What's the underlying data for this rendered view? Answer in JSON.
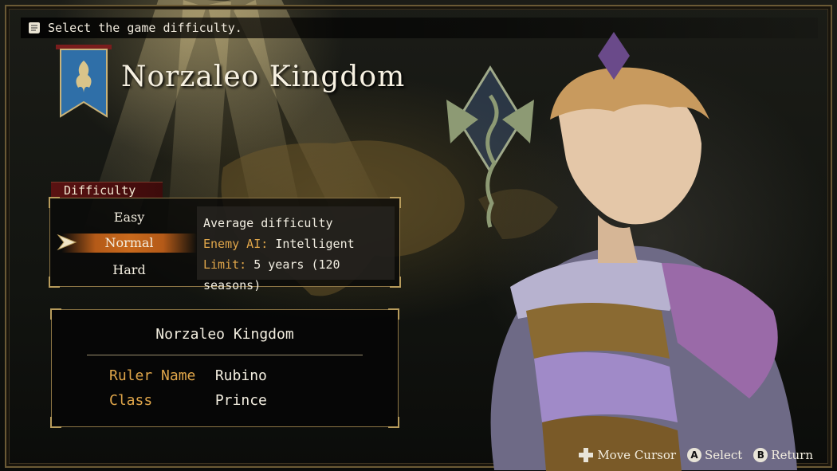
{
  "hint_bar": {
    "text": "Select the game difficulty.",
    "icon": "scroll-icon"
  },
  "header": {
    "title": "Norzaleo Kingdom",
    "banner_icon": "dragon-banner-icon"
  },
  "difficulty": {
    "tab_label": "Difficulty",
    "options": [
      "Easy",
      "Normal",
      "Hard"
    ],
    "selected": "Normal",
    "info": {
      "description": "Average difficulty",
      "enemy_ai_label": "Enemy AI:",
      "enemy_ai_value": "Intelligent",
      "limit_label": "Limit:",
      "limit_value": "5 years (120 seasons)"
    }
  },
  "info_panel": {
    "title": "Norzaleo Kingdom",
    "ruler_label": "Ruler Name",
    "ruler_value": "Rubino",
    "class_label": "Class",
    "class_value": "Prince"
  },
  "button_hints": [
    {
      "icon": "dpad-icon",
      "label": "Move Cursor"
    },
    {
      "icon": "a-button-icon",
      "glyph": "A",
      "label": "Select"
    },
    {
      "icon": "b-button-icon",
      "glyph": "B",
      "label": "Return"
    }
  ],
  "colors": {
    "accent_gold": "#e0a64a",
    "selection_orange": "#c8691c",
    "tab_red": "#5a1212",
    "banner_blue": "#2f6fa8"
  }
}
